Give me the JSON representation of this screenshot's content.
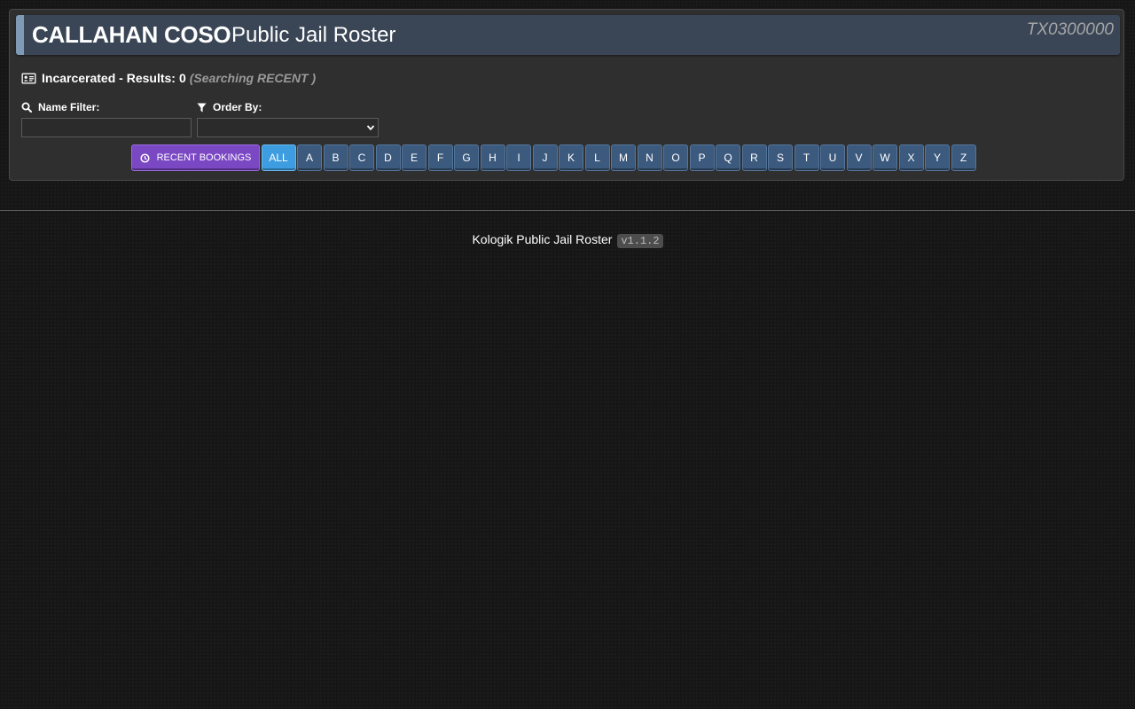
{
  "header": {
    "agency": "CALLAHAN COSO",
    "title": "Public Jail Roster",
    "ori": "TX0300000"
  },
  "results": {
    "label": "Incarcerated - Results:",
    "count": "0",
    "searching": "(Searching RECENT )"
  },
  "filters": {
    "name_label": "Name Filter:",
    "name_value": "",
    "order_label": "Order By:",
    "order_value": ""
  },
  "buttons": {
    "recent": "RECENT BOOKINGS",
    "all": "ALL",
    "letters": [
      "A",
      "B",
      "C",
      "D",
      "E",
      "F",
      "G",
      "H",
      "I",
      "J",
      "K",
      "L",
      "M",
      "N",
      "O",
      "P",
      "Q",
      "R",
      "S",
      "T",
      "U",
      "V",
      "W",
      "X",
      "Y",
      "Z"
    ]
  },
  "footer": {
    "text": "Kologik Public Jail Roster",
    "version": "v1.1.2"
  },
  "colors": {
    "header_bg": "#3a4656",
    "recent_button": "#7b48c4",
    "all_button": "#3d9de0",
    "letter_button": "#3c5a7e"
  },
  "icons": [
    "id-card-icon",
    "search-icon",
    "filter-icon",
    "clock-icon",
    "chevron-down-icon"
  ]
}
